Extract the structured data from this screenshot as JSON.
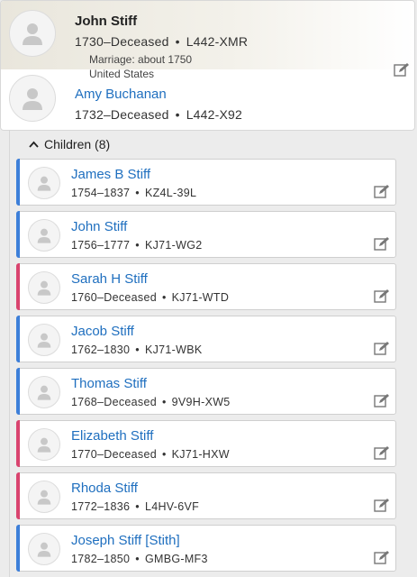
{
  "couple": {
    "husband": {
      "name": "John Stiff",
      "lifespan": "1730–Deceased",
      "id": "L442-XMR"
    },
    "marriage": {
      "label": "Marriage: about 1750",
      "place": "United States"
    },
    "wife": {
      "name": "Amy Buchanan",
      "lifespan": "1732–Deceased",
      "id": "L442-X92"
    }
  },
  "children": {
    "header": "Children (8)",
    "items": [
      {
        "name": "James B Stiff",
        "lifespan": "1754–1837",
        "id": "KZ4L-39L",
        "sex": "male"
      },
      {
        "name": "John Stiff",
        "lifespan": "1756–1777",
        "id": "KJ71-WG2",
        "sex": "male"
      },
      {
        "name": "Sarah H Stiff",
        "lifespan": "1760–Deceased",
        "id": "KJ71-WTD",
        "sex": "female"
      },
      {
        "name": "Jacob Stiff",
        "lifespan": "1762–1830",
        "id": "KJ71-WBK",
        "sex": "male"
      },
      {
        "name": "Thomas Stiff",
        "lifespan": "1768–Deceased",
        "id": "9V9H-XW5",
        "sex": "male"
      },
      {
        "name": "Elizabeth Stiff",
        "lifespan": "1770–Deceased",
        "id": "KJ71-HXW",
        "sex": "female"
      },
      {
        "name": "Rhoda Stiff",
        "lifespan": "1772–1836",
        "id": "L4HV-6VF",
        "sex": "female"
      },
      {
        "name": "Joseph Stiff [Stith]",
        "lifespan": "1782–1850",
        "id": "GMBG-MF3",
        "sex": "male"
      }
    ]
  },
  "colors": {
    "male": "#3d7fd9",
    "female": "#d9446f",
    "link": "#1f6fbf"
  },
  "icons": {
    "avatar": "person-silhouette-icon",
    "edit": "edit-pencil-icon",
    "collapse": "chevron-up-icon"
  }
}
